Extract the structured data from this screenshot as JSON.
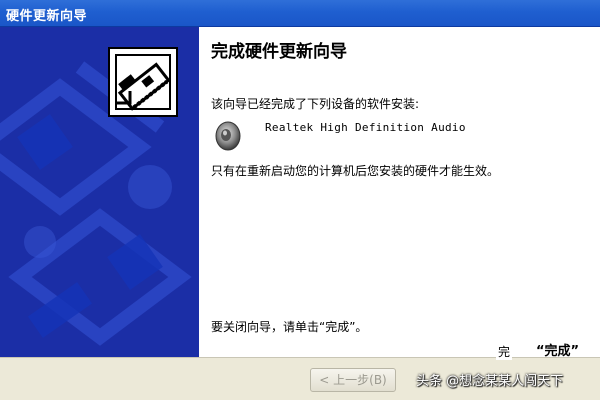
{
  "window": {
    "title": "硬件更新向导"
  },
  "wizard": {
    "heading": "完成硬件更新向导",
    "line1": "该向导已经完成了下列设备的软件安装:",
    "device_name": "Realtek High Definition Audio",
    "line2": "只有在重新启动您的计算机后您安装的硬件才能生效。",
    "line3": "要关闭向导，请单击“完成”。"
  },
  "buttons": {
    "back_label": "< 上一步(B)"
  },
  "overlay": {
    "finish_partial": "完",
    "finish_quote": "“完成”"
  },
  "watermark": "头条 @想念某某人闯天下",
  "icons": {
    "wizard_icon": "hardware-card-icon",
    "device_icon": "speaker-icon"
  },
  "colors": {
    "titlebar": "#1f5fd0",
    "left_panel": "#1b2ea6",
    "button_face": "#ece9d8"
  }
}
